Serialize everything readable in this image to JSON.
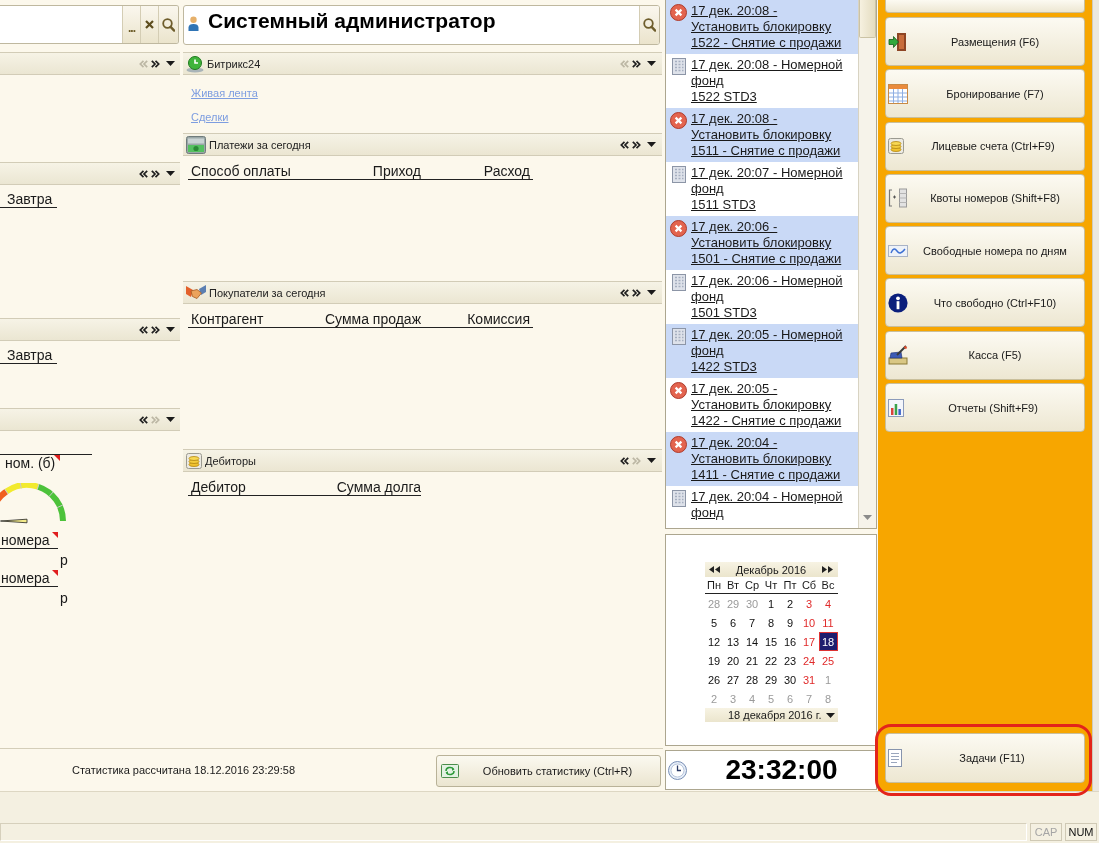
{
  "left_column": {
    "search_field": {
      "select_label": "..."
    },
    "panels": [
      {
        "back_enabled": false,
        "forward_enabled": true
      },
      {
        "back_enabled": true,
        "forward_enabled": true,
        "columns": [
          "Завтра"
        ]
      },
      {
        "back_enabled": true,
        "forward_enabled": true,
        "columns": [
          "Завтра"
        ]
      },
      {
        "back_enabled": true,
        "forward_enabled": false,
        "gauge": {
          "label": "ном. (б)",
          "marked": true,
          "level": 0
        },
        "fields": [
          {
            "label": "номера",
            "marked": true,
            "unit": "р"
          },
          {
            "label": "номера",
            "marked": true,
            "unit": "р"
          }
        ]
      }
    ]
  },
  "main_column": {
    "user_field": {
      "value": "Системный администратор"
    },
    "panels": [
      {
        "title": "Битрикс24",
        "kind": "bitrix",
        "back_enabled": false,
        "forward_enabled": true,
        "links": [
          "Живая лента",
          "Сделки"
        ]
      },
      {
        "title": "Платежи за сегодня",
        "kind": "payments",
        "back_enabled": true,
        "forward_enabled": true,
        "columns": [
          "Способ оплаты",
          "Приход",
          "Расход"
        ]
      },
      {
        "title": "Покупатели за сегодня",
        "kind": "buyers",
        "back_enabled": true,
        "forward_enabled": true,
        "columns": [
          "Контрагент",
          "Сумма продаж",
          "Комиссия"
        ]
      },
      {
        "title": "Дебиторы",
        "kind": "debtors",
        "back_enabled": true,
        "forward_enabled": false,
        "columns": [
          "Дебитор",
          "Сумма долга"
        ]
      }
    ]
  },
  "statistics_bar": {
    "status": "Статистика рассчитана 18.12.2016 23:29:58",
    "refresh_button": "Обновить статистику (Ctrl+R)"
  },
  "events": [
    {
      "kind": "block",
      "lines": [
        "17 дек. 20:08 -",
        "Установить блокировку",
        "1522 - Снятие с продажи"
      ]
    },
    {
      "kind": "room",
      "lines": [
        "17 дек. 20:08 - Номерной",
        "фонд",
        "1522 STD3"
      ]
    },
    {
      "kind": "block",
      "lines": [
        "17 дек. 20:08 -",
        "Установить блокировку",
        "1511 - Снятие с продажи"
      ]
    },
    {
      "kind": "room",
      "lines": [
        "17 дек. 20:07 - Номерной",
        "фонд",
        "1511 STD3"
      ]
    },
    {
      "kind": "block",
      "lines": [
        "17 дек. 20:06 -",
        "Установить блокировку",
        "1501 - Снятие с продажи"
      ]
    },
    {
      "kind": "room",
      "lines": [
        "17 дек. 20:06 - Номерной",
        "фонд",
        "1501 STD3"
      ]
    },
    {
      "kind": "room",
      "lines": [
        "17 дек. 20:05 - Номерной",
        "фонд",
        "1422 STD3"
      ]
    },
    {
      "kind": "block",
      "lines": [
        "17 дек. 20:05 -",
        "Установить блокировку",
        "1422 - Снятие с продажи"
      ]
    },
    {
      "kind": "block",
      "lines": [
        "17 дек. 20:04 -",
        "Установить блокировку",
        "1411 - Снятие с продажи"
      ]
    },
    {
      "kind": "room",
      "lines": [
        "17 дек. 20:04 - Номерной",
        "фонд"
      ]
    }
  ],
  "calendar": {
    "month": "Декабрь 2016",
    "weekdays": [
      "Пн",
      "Вт",
      "Ср",
      "Чт",
      "Пт",
      "Сб",
      "Вс"
    ],
    "weeks": [
      [
        {
          "day": "28",
          "kind": "adjacent",
          "selected": false
        },
        {
          "day": "29",
          "kind": "adjacent",
          "selected": false
        },
        {
          "day": "30",
          "kind": "adjacent",
          "selected": false
        },
        {
          "day": "1",
          "kind": "workday",
          "selected": false
        },
        {
          "day": "2",
          "kind": "workday",
          "selected": false
        },
        {
          "day": "3",
          "kind": "weekend",
          "selected": false
        },
        {
          "day": "4",
          "kind": "weekend",
          "selected": false
        }
      ],
      [
        {
          "day": "5",
          "kind": "workday",
          "selected": false
        },
        {
          "day": "6",
          "kind": "workday",
          "selected": false
        },
        {
          "day": "7",
          "kind": "workday",
          "selected": false
        },
        {
          "day": "8",
          "kind": "workday",
          "selected": false
        },
        {
          "day": "9",
          "kind": "workday",
          "selected": false
        },
        {
          "day": "10",
          "kind": "weekend",
          "selected": false
        },
        {
          "day": "11",
          "kind": "weekend",
          "selected": false
        }
      ],
      [
        {
          "day": "12",
          "kind": "workday",
          "selected": false
        },
        {
          "day": "13",
          "kind": "workday",
          "selected": false
        },
        {
          "day": "14",
          "kind": "workday",
          "selected": false
        },
        {
          "day": "15",
          "kind": "workday",
          "selected": false
        },
        {
          "day": "16",
          "kind": "workday",
          "selected": false
        },
        {
          "day": "17",
          "kind": "weekend",
          "selected": false
        },
        {
          "day": "18",
          "kind": "weekend",
          "selected": true
        }
      ],
      [
        {
          "day": "19",
          "kind": "workday",
          "selected": false
        },
        {
          "day": "20",
          "kind": "workday",
          "selected": false
        },
        {
          "day": "21",
          "kind": "workday",
          "selected": false
        },
        {
          "day": "22",
          "kind": "workday",
          "selected": false
        },
        {
          "day": "23",
          "kind": "workday",
          "selected": false
        },
        {
          "day": "24",
          "kind": "weekend",
          "selected": false
        },
        {
          "day": "25",
          "kind": "weekend",
          "selected": false
        }
      ],
      [
        {
          "day": "26",
          "kind": "workday",
          "selected": false
        },
        {
          "day": "27",
          "kind": "workday",
          "selected": false
        },
        {
          "day": "28",
          "kind": "workday",
          "selected": false
        },
        {
          "day": "29",
          "kind": "workday",
          "selected": false
        },
        {
          "day": "30",
          "kind": "workday",
          "selected": false
        },
        {
          "day": "31",
          "kind": "weekend",
          "selected": false
        },
        {
          "day": "1",
          "kind": "adjacent",
          "selected": false
        }
      ],
      [
        {
          "day": "2",
          "kind": "adjacent",
          "selected": false
        },
        {
          "day": "3",
          "kind": "adjacent",
          "selected": false
        },
        {
          "day": "4",
          "kind": "adjacent",
          "selected": false
        },
        {
          "day": "5",
          "kind": "adjacent",
          "selected": false
        },
        {
          "day": "6",
          "kind": "adjacent",
          "selected": false
        },
        {
          "day": "7",
          "kind": "adjacent",
          "selected": false
        },
        {
          "day": "8",
          "kind": "adjacent",
          "selected": false
        }
      ]
    ],
    "date_field": "18 декабря 2016 г."
  },
  "clock": {
    "time": "23:32:00"
  },
  "nav": {
    "partial_button": true,
    "buttons": [
      {
        "label": "Размещения (F6)",
        "kind": "checkin"
      },
      {
        "label": "Бронирование (F7)",
        "kind": "booking"
      },
      {
        "label": "Лицевые счета (Ctrl+F9)",
        "kind": "accounts"
      },
      {
        "label": "Квоты номеров (Shift+F8)",
        "kind": "quotas"
      },
      {
        "label": "Свободные номера по дням",
        "kind": "availability"
      },
      {
        "label": "Что свободно (Ctrl+F10)",
        "kind": "info"
      },
      {
        "label": "Касса (F5)",
        "kind": "cash"
      },
      {
        "label": "Отчеты (Shift+F9)",
        "kind": "reports"
      }
    ],
    "tasks_button": {
      "label": "Задачи (F11)",
      "kind": "tasks",
      "highlighted": true
    }
  },
  "status_bar": {
    "indicators": [
      {
        "label": "CAP",
        "on": false
      },
      {
        "label": "NUM",
        "on": true
      }
    ]
  }
}
